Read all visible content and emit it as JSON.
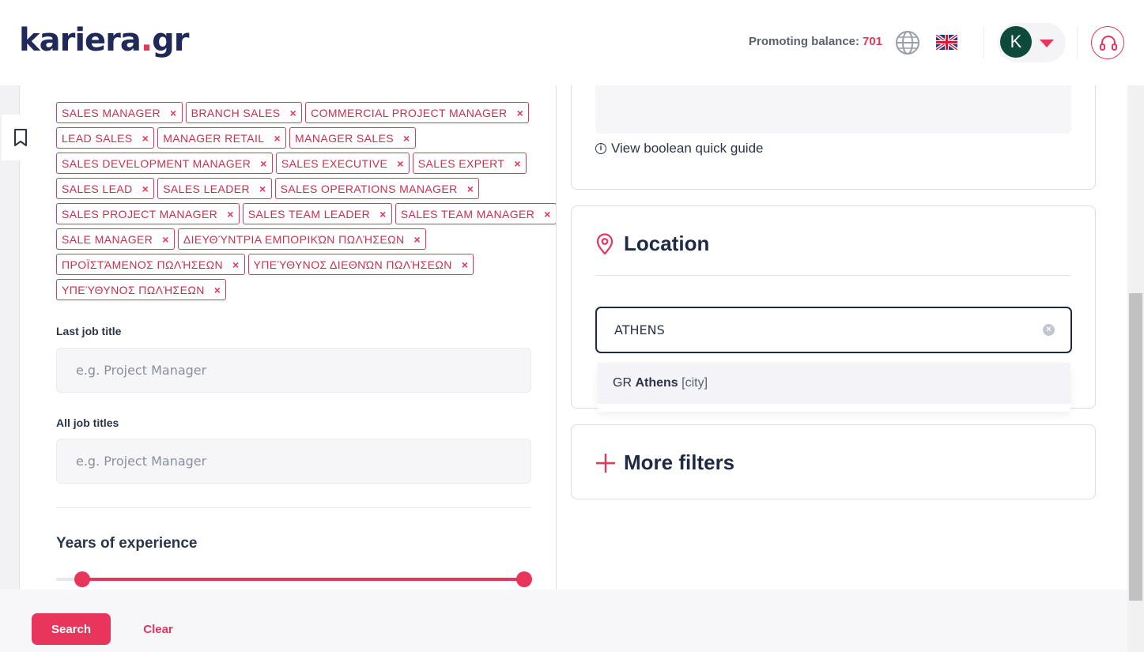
{
  "header": {
    "logo_text": "kariera",
    "logo_dot": ".",
    "logo_tld": "gr",
    "promo_label": "Promoting balance:",
    "promo_value": "701",
    "avatar_initial": "K",
    "globe_icon": "globe-icon",
    "flag_icon": "uk-flag-icon",
    "support_icon": "headset-icon"
  },
  "tags": {
    "rows": [
      [
        "SALES MANAGER",
        "BRANCH SALES",
        "COMMERCIAL PROJECT MANAGER"
      ],
      [
        "LEAD SALES",
        "MANAGER RETAIL",
        "MANAGER SALES"
      ],
      [
        "SALES DEVELOPMENT MANAGER",
        "SALES EXECUTIVE",
        "SALES EXPERT"
      ],
      [
        "SALES LEAD",
        "SALES LEADER",
        "SALES OPERATIONS MANAGER"
      ],
      [
        "SALES PROJECT MANAGER",
        "SALES TEAM LEADER",
        "SALES TEAM MANAGER"
      ],
      [
        "SALE MANAGER",
        "ΔΙΕΥΘΎΝΤΡΙΑ ΕΜΠΟΡΙΚΏΝ ΠΩΛΉΣΕΩΝ"
      ],
      [
        "ΠΡΟΪΣΤΆΜΕΝΟΣ ΠΩΛΉΣΕΩΝ",
        "ΥΠΕΎΘΥΝΟΣ ΔΙΕΘΝΏΝ ΠΩΛΉΣΕΩΝ"
      ],
      [
        "ΥΠΕΎΘΥΝΟΣ ΠΩΛΉΣΕΩΝ"
      ]
    ],
    "remove_glyph": "×"
  },
  "last_job_title": {
    "label": "Last job title",
    "placeholder": "e.g. Project Manager",
    "value": ""
  },
  "all_job_titles": {
    "label": "All job titles",
    "placeholder": "e.g. Project Manager",
    "value": ""
  },
  "experience": {
    "title": "Years of experience",
    "range_start_fraction": 0.055,
    "range_end_fraction": 0.985
  },
  "boolean": {
    "guide_link": "View boolean quick guide",
    "info_glyph": "i"
  },
  "location": {
    "title": "Location",
    "input_value": "ATHENS",
    "clear_glyph": "×",
    "suggestion_country": "GR",
    "suggestion_city": "Athens",
    "suggestion_type": "[city]"
  },
  "more_filters": {
    "title": "More filters"
  },
  "actions": {
    "search_label": "Search",
    "clear_label": "Clear"
  },
  "colors": {
    "accent": "#e8355c",
    "navy": "#1f2a44",
    "avatar_bg": "#0e4a3c"
  }
}
